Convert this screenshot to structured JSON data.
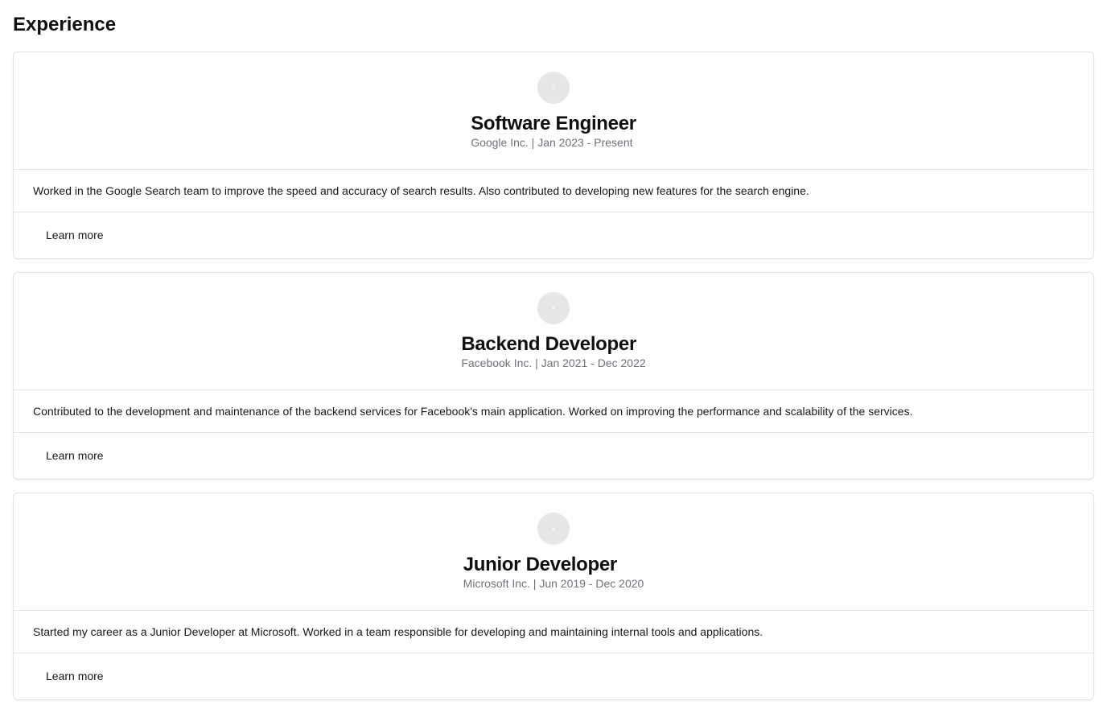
{
  "section": {
    "title": "Experience"
  },
  "experiences": [
    {
      "title": "Software Engineer",
      "meta": "Google Inc. | Jan 2023 - Present",
      "description": "Worked in the Google Search team to improve the speed and accuracy of search results. Also contributed to developing new features for the search engine.",
      "button_label": "Learn more"
    },
    {
      "title": "Backend Developer",
      "meta": "Facebook Inc. | Jan 2021 - Dec 2022",
      "description": "Contributed to the development and maintenance of the backend services for Facebook's main application. Worked on improving the performance and scalability of the services.",
      "button_label": "Learn more"
    },
    {
      "title": "Junior Developer",
      "meta": "Microsoft Inc. | Jun 2019 - Dec 2020",
      "description": "Started my career as a Junior Developer at Microsoft. Worked in a team responsible for developing and maintaining internal tools and applications.",
      "button_label": "Learn more"
    }
  ],
  "colors": {
    "border": "#e4e4e7",
    "muted_text": "#71717a",
    "avatar_bg": "#e7e7e7"
  },
  "icons": {
    "avatar": "avatar-placeholder-icon"
  }
}
